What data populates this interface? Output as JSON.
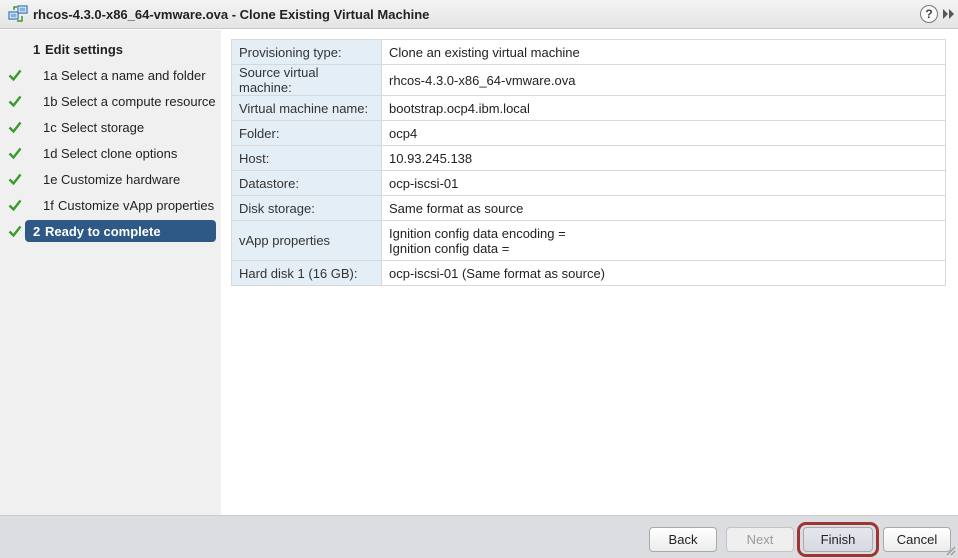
{
  "window": {
    "title": "rhcos-4.3.0-x86_64-vmware.ova - Clone Existing Virtual Machine",
    "help_label": "?"
  },
  "steps": [
    {
      "num": "1",
      "label": "Edit settings",
      "state": "header"
    },
    {
      "num": "1a",
      "label": "Select a name and folder",
      "state": "done"
    },
    {
      "num": "1b",
      "label": "Select a compute resource",
      "state": "done"
    },
    {
      "num": "1c",
      "label": "Select storage",
      "state": "done"
    },
    {
      "num": "1d",
      "label": "Select clone options",
      "state": "done"
    },
    {
      "num": "1e",
      "label": "Customize hardware",
      "state": "done"
    },
    {
      "num": "1f",
      "label": "Customize vApp properties",
      "state": "done"
    },
    {
      "num": "2",
      "label": "Ready to complete",
      "state": "active"
    }
  ],
  "review": [
    {
      "key": "Provisioning type:",
      "value": "Clone an existing virtual machine"
    },
    {
      "key": "Source virtual machine:",
      "value": "rhcos-4.3.0-x86_64-vmware.ova"
    },
    {
      "key": "Virtual machine name:",
      "value": "bootstrap.ocp4.ibm.local"
    },
    {
      "key": "Folder:",
      "value": "ocp4"
    },
    {
      "key": "Host:",
      "value": "10.93.245.138"
    },
    {
      "key": "Datastore:",
      "value": "ocp-iscsi-01"
    },
    {
      "key": "Disk storage:",
      "value": "Same format as source"
    },
    {
      "key": "vApp properties",
      "value": "Ignition config data encoding =",
      "value2": "Ignition config data ="
    },
    {
      "key": "Hard disk 1 (16 GB):",
      "value": "ocp-iscsi-01 (Same format as source)"
    }
  ],
  "footer": {
    "back": "Back",
    "next": "Next",
    "finish": "Finish",
    "cancel": "Cancel"
  },
  "colors": {
    "active_step": "#2e5885",
    "check": "#3a9a2e",
    "key_cell": "#e4eef6",
    "finish_highlight": "#9e3535"
  }
}
